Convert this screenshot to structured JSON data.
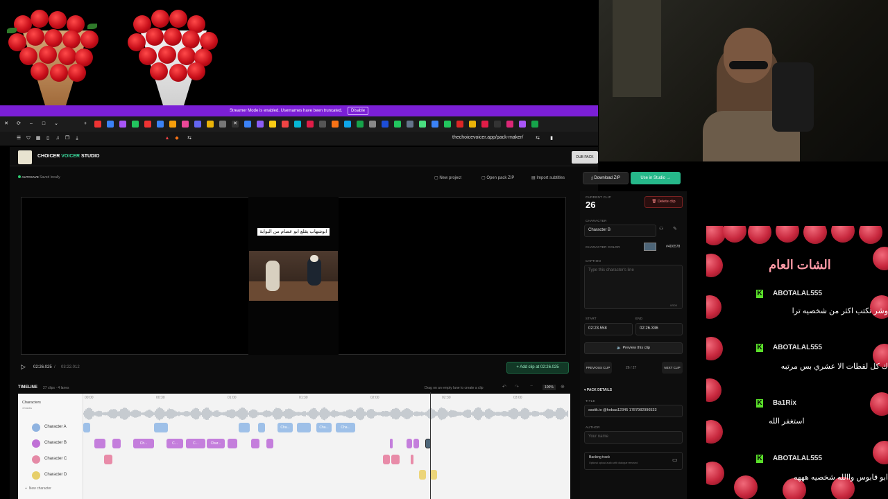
{
  "banner": {
    "text": "Streamer Mode is enabled. Usernames have been truncated.",
    "button": "Disable"
  },
  "browser": {
    "url": "thechoicevoicer.app/pack-maker/"
  },
  "app": {
    "title_prefix": "CHOICER",
    "title_accent": "VOICER",
    "title_suffix": "STUDIO",
    "dub_button": "DUB PACK MAKER",
    "autosave_label": "AUTOSAVE",
    "autosave_status": "Saved locally",
    "actions": [
      "New project",
      "Open pack ZIP",
      "Import subtitles"
    ],
    "download_zip": "Download ZIP",
    "use_in_studio": "Use in Studio"
  },
  "preview": {
    "caption": "ابوشهاب يقلع ابو عصام من البوابة",
    "current_time": "02:26.025",
    "total_time": "03:22.012",
    "add_clip": "Add clip at 02:26.025"
  },
  "timeline": {
    "title": "TIMELINE",
    "meta": "27 clips · 4 lanes",
    "hint": "Drag on an empty lane to create a clip",
    "zoom": "100%",
    "ticks": [
      "00:00",
      "00:30",
      "01:00",
      "01:30",
      "02:00",
      "02:30",
      "03:00"
    ],
    "lanes_header": "Characters",
    "lanes_sub": "4 tracks",
    "lanes": [
      {
        "name": "Character A",
        "color": "#8fb3e0"
      },
      {
        "name": "Character B",
        "color": "#c071d6"
      },
      {
        "name": "Character C",
        "color": "#e58aa6"
      },
      {
        "name": "Character D",
        "color": "#e7cf6a"
      }
    ],
    "clip_labels": {
      "a": "Cha...",
      "b1": "Ch...",
      "b2": "C...",
      "b3": "Char..."
    },
    "new_character": "New character"
  },
  "clip_panel": {
    "current_label": "CURRENT CLIP",
    "current_number": "26",
    "delete": "Delete clip",
    "character_label": "CHARACTER",
    "character_value": "Character B",
    "color_label": "CHARACTER COLOR",
    "color_value": "#4D6578",
    "caption_label": "CAPTION",
    "caption_placeholder": "Type this character's line",
    "char_count": "0/500",
    "start_label": "START",
    "start_value": "02:23.558",
    "end_label": "END",
    "end_value": "02:26.336",
    "preview": "Preview this clip",
    "prev": "PREVIOUS CLIP",
    "counter": "26 / 27",
    "next": "NEXT CLIP",
    "pack_details": "PACK DETAILS",
    "title_label": "TITLE",
    "title_value": "ssstik.io @hobaa12345 1787982996533",
    "author_label": "AUTHOR",
    "author_placeholder": "Your name",
    "backing_track": "Backing track",
    "backing_desc": "Optional upload audio with dialogue removed"
  },
  "chat": {
    "title": "الشات العام",
    "messages": [
      {
        "user": "ABOTALAL555",
        "text": "وشر تكتب اكثر من شخصيه ترا"
      },
      {
        "user": "ABOTALAL555",
        "text": "ك كل لقطات الا عشري بس مرتبه"
      },
      {
        "user": "Ba1Rix",
        "text": "استغفر الله"
      },
      {
        "user": "ABOTALAL555",
        "text": "ابو قابوس واالله شخصيه هههه"
      }
    ]
  }
}
